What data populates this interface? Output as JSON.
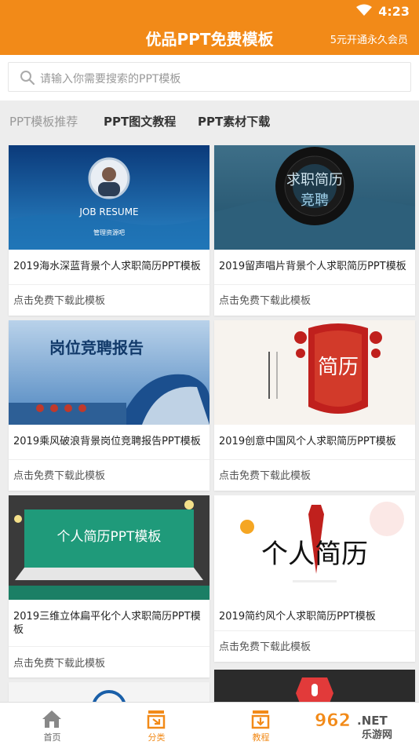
{
  "status": {
    "time": "4:23"
  },
  "header": {
    "title": "优品PPT免费模板",
    "vip_link": "5元开通永久会员"
  },
  "search": {
    "placeholder": "请输入你需要搜索的PPT模板"
  },
  "tabs": [
    {
      "label": "PPT模板推荐"
    },
    {
      "label": "PPT图文教程"
    },
    {
      "label": "PPT素材下载"
    }
  ],
  "cards": [
    {
      "title": "2019海水深蓝背景个人求职简历PPT模板",
      "action": "点击免费下载此模板",
      "thumb_text": "JOB RESUME",
      "thumb_sub": "管理资源吧"
    },
    {
      "title": "2019留声唱片背景个人求职简历PPT模板",
      "action": "点击免费下载此模板",
      "thumb_text": "求职简历",
      "thumb_sub": "竞聘"
    },
    {
      "title": "2019乘风破浪背景岗位竞聘报告PPT模板",
      "action": "点击免费下载此模板",
      "thumb_text": "岗位竞聘报告"
    },
    {
      "title": "2019创意中国风个人求职简历PPT模板",
      "action": "点击免费下载此模板",
      "thumb_text": "简历"
    },
    {
      "title": "2019三维立体扁平化个人求职简历PPT模板",
      "action": "点击免费下载此模板",
      "thumb_text": "个人简历PPT模板"
    },
    {
      "title": "2019简约风个人求职简历PPT模板",
      "action": "点击免费下载此模板",
      "thumb_text": "个人简历"
    }
  ],
  "bottom_nav": [
    {
      "label": "首页",
      "icon": "home-icon"
    },
    {
      "label": "分类",
      "icon": "category-icon"
    },
    {
      "label": "教程",
      "icon": "tutorial-icon"
    },
    {
      "label": "",
      "icon": "more-icon"
    }
  ],
  "watermark": {
    "text": "962.NET",
    "sub": "乐游网"
  },
  "colors": {
    "accent": "#f28a18",
    "background": "#ededed"
  }
}
